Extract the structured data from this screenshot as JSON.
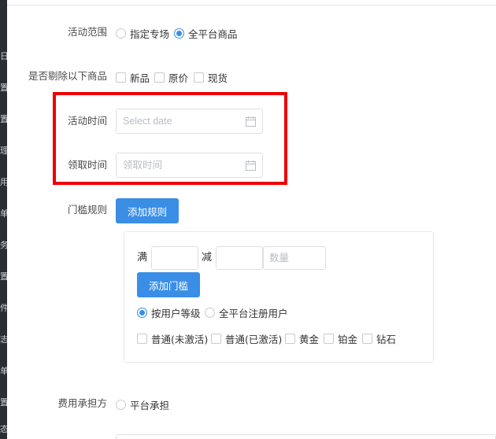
{
  "sidebar": {
    "ghost_chars": [
      "日",
      "置",
      "置",
      "理",
      "用",
      "单",
      "务",
      "置",
      "件",
      "志",
      "单",
      "置",
      "态"
    ]
  },
  "form": {
    "scope": {
      "label": "活动范围",
      "options": [
        {
          "label": "指定专场",
          "checked": false
        },
        {
          "label": "全平台商品",
          "checked": true
        }
      ]
    },
    "exclude": {
      "label": "是否剔除以下商品",
      "options": [
        {
          "label": "新品",
          "checked": false
        },
        {
          "label": "原价",
          "checked": false
        },
        {
          "label": "现货",
          "checked": false
        }
      ]
    },
    "activity_time": {
      "label": "活动时间",
      "placeholder": "Select date",
      "icon": "calendar-icon"
    },
    "claim_time": {
      "label": "领取时间",
      "placeholder": "领取时间",
      "icon": "calendar-icon"
    },
    "threshold": {
      "label": "门槛规则",
      "add_rule_button": "添加规则",
      "full_label": "满",
      "minus_label": "减",
      "quantity_placeholder": "数量",
      "add_threshold_button": "添加门槛",
      "user_type_options": [
        {
          "label": "按用户等级",
          "checked": true
        },
        {
          "label": "全平台注册用户",
          "checked": false
        }
      ],
      "levels": [
        {
          "label": "普通(未激活)",
          "checked": false
        },
        {
          "label": "普通(已激活)",
          "checked": false
        },
        {
          "label": "黄金",
          "checked": false
        },
        {
          "label": "铂金",
          "checked": false
        },
        {
          "label": "钻石",
          "checked": false
        }
      ]
    },
    "cost": {
      "label": "费用承担方",
      "options": [
        {
          "label": "平台承担",
          "checked": false
        }
      ]
    }
  },
  "colors": {
    "primary": "#3a8ee6",
    "highlight": "#ee0000"
  }
}
